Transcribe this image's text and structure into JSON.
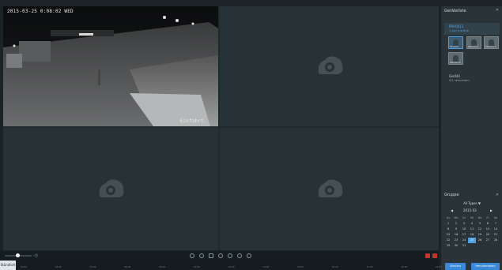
{
  "video_grid": {
    "cells": [
      {
        "id": "cell-1",
        "timestamp": "2015-03-25  0:08:02  WED",
        "camera_name": "Einfahrt"
      },
      {
        "id": "cell-2"
      },
      {
        "id": "cell-3"
      },
      {
        "id": "cell-4"
      }
    ]
  },
  "device_panel": {
    "title": "Geräteliste",
    "close_icon": "close-icon",
    "group1": {
      "name": "PRH0013",
      "sub": "1 von 4 online"
    },
    "tiles": [
      {
        "label": "Einfahrt",
        "active": true
      },
      {
        "label": "Kamera 2",
        "active": false
      },
      {
        "label": "Kamera 3",
        "active": false
      },
      {
        "label": "Kamera 4",
        "active": false
      }
    ],
    "group2": {
      "name": "Gerät3",
      "sub": "0/1 verbunden"
    }
  },
  "calendar_panel": {
    "title": "Gruppe",
    "type_selector": "All Types ▼",
    "month_label": "2015-03",
    "weekdays": [
      "Su",
      "Mo",
      "Di",
      "Mi",
      "Do",
      "Fr",
      "Sa"
    ],
    "weeks": [
      [
        "1",
        "2",
        "3",
        "4",
        "5",
        "6",
        "7"
      ],
      [
        "8",
        "9",
        "10",
        "11",
        "12",
        "13",
        "14"
      ],
      [
        "15",
        "16",
        "17",
        "18",
        "19",
        "20",
        "21"
      ],
      [
        "22",
        "23",
        "24",
        "25",
        "26",
        "27",
        "28"
      ],
      [
        "29",
        "30",
        "31",
        "",
        "",
        "",
        ""
      ]
    ],
    "selected_day": "25"
  },
  "buttons": {
    "download": "Abrufen",
    "export": "Herunterladen"
  },
  "controls": {
    "volume_icon": "volume-icon"
  },
  "timeline": {
    "segment_label": "Stündlich",
    "ticks": [
      "00:00",
      "02:00",
      "04:00",
      "06:00",
      "08:00",
      "10:00",
      "12:00",
      "14:00",
      "16:00",
      "18:00",
      "20:00",
      "22:00",
      "24:00"
    ]
  },
  "colors": {
    "accent": "#3a89d8",
    "selected": "#4aa0e0",
    "record": "#c0392b"
  }
}
